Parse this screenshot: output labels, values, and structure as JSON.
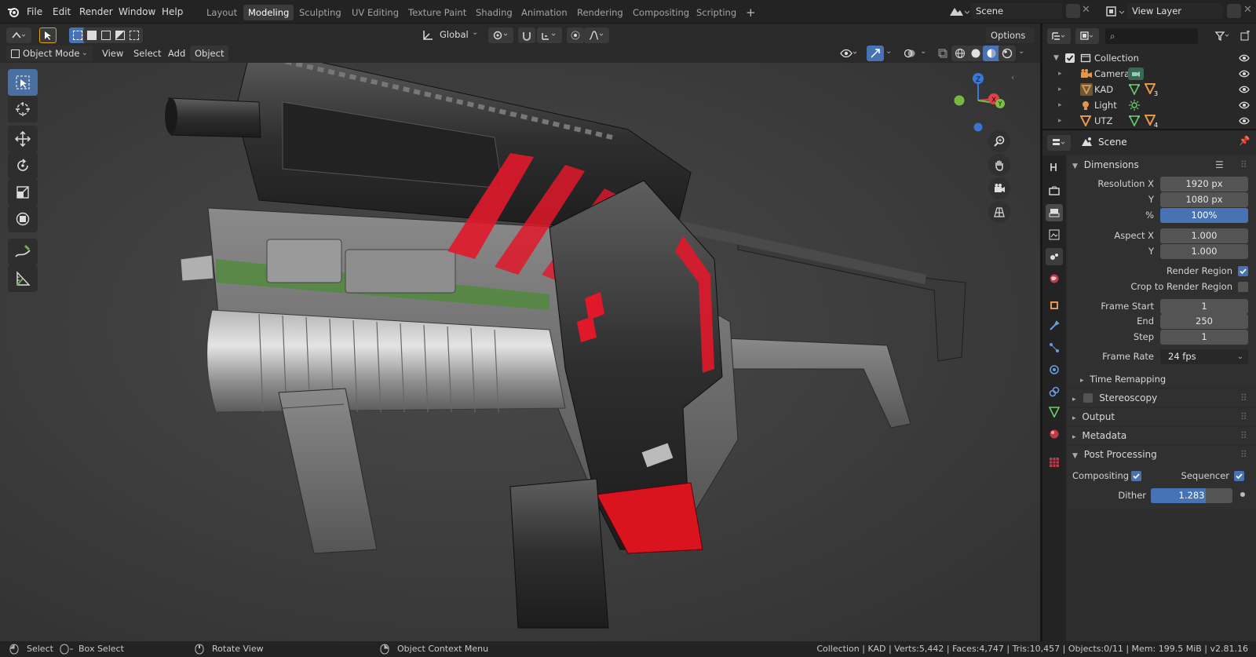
{
  "menu": [
    "File",
    "Edit",
    "Render",
    "Window",
    "Help"
  ],
  "workspaces": [
    "Layout",
    "Modeling",
    "Sculpting",
    "UV Editing",
    "Texture Paint",
    "Shading",
    "Animation",
    "Rendering",
    "Compositing",
    "Scripting"
  ],
  "active_workspace": "Modeling",
  "scene_name": "Scene",
  "view_layer": "View Layer",
  "header": {
    "orientation": "Global",
    "options": "Options",
    "mode": "Object Mode",
    "view": "View",
    "select": "Select",
    "add": "Add",
    "object": "Object"
  },
  "outliner": {
    "search_placeholder": "",
    "items": [
      {
        "label": "Collection"
      },
      {
        "label": "Camera"
      },
      {
        "label": "KAD",
        "badge": "3"
      },
      {
        "label": "Light"
      },
      {
        "label": "UTZ",
        "badge": "4"
      }
    ]
  },
  "properties": {
    "context": "Scene",
    "dimensions": {
      "title": "Dimensions",
      "resolution_x_label": "Resolution X",
      "resolution_x": "1920 px",
      "y_label": "Y",
      "resolution_y": "1080 px",
      "pct_label": "%",
      "resolution_pct": "100%",
      "aspect_x_label": "Aspect X",
      "aspect_x": "1.000",
      "aspect_y": "1.000",
      "render_region": "Render Region",
      "crop_region": "Crop to Render Region",
      "frame_start_label": "Frame Start",
      "frame_start": "1",
      "end_label": "End",
      "frame_end": "250",
      "step_label": "Step",
      "frame_step": "1",
      "frame_rate_label": "Frame Rate",
      "frame_rate": "24 fps",
      "time_remapping": "Time Remapping"
    },
    "stereoscopy": "Stereoscopy",
    "output": "Output",
    "metadata": "Metadata",
    "post_processing": {
      "title": "Post Processing",
      "compositing": "Compositing",
      "sequencer": "Sequencer",
      "dither_label": "Dither",
      "dither": "1.283"
    }
  },
  "status": {
    "select": "Select",
    "box_select": "Box Select",
    "rotate_view": "Rotate View",
    "context_menu": "Object Context Menu",
    "stats": "Collection | KAD | Verts:5,442 | Faces:4,747 | Tris:10,457 | Objects:0/11 | Mem: 199.5 MiB | v2.81.16"
  },
  "colors": {
    "accent": "#4772b3",
    "gun_red": "#e0182a",
    "gun_body": "#2b2b2b",
    "viewport_bg": "#3c3c3c"
  }
}
